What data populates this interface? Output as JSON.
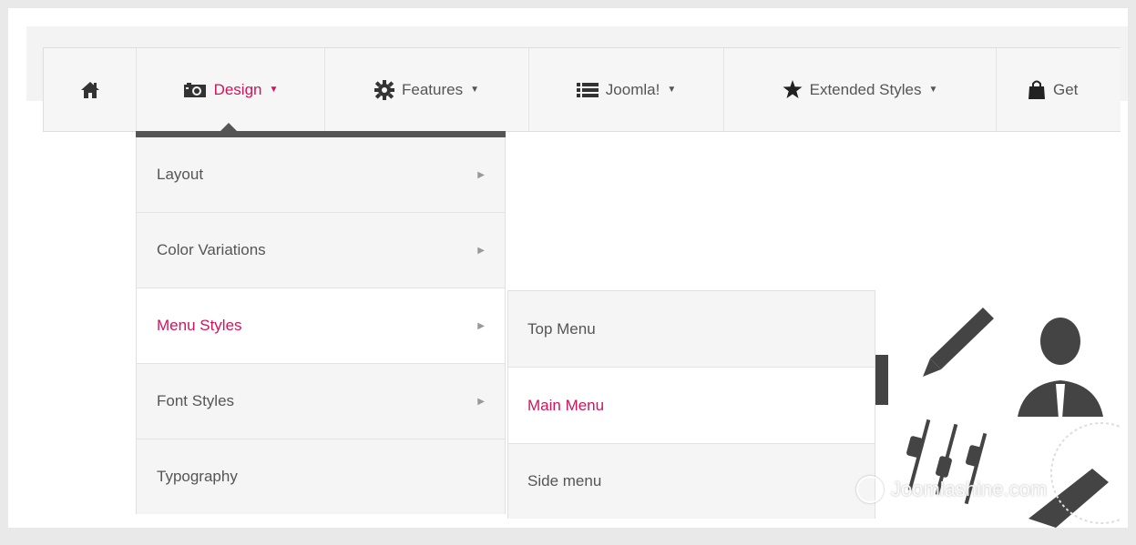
{
  "nav": {
    "items": [
      {
        "label": "",
        "icon": "home-icon"
      },
      {
        "label": "Design",
        "icon": "camera-icon",
        "active": true
      },
      {
        "label": "Features",
        "icon": "gear-icon"
      },
      {
        "label": "Joomla!",
        "icon": "list-icon"
      },
      {
        "label": "Extended Styles",
        "icon": "star-icon"
      },
      {
        "label": "Get",
        "icon": "shopping-bag-icon"
      }
    ]
  },
  "dropdown": {
    "items": [
      {
        "label": "Layout"
      },
      {
        "label": "Color Variations"
      },
      {
        "label": "Menu Styles",
        "active": true
      },
      {
        "label": "Font Styles"
      },
      {
        "label": "Typography"
      }
    ]
  },
  "submenu": {
    "items": [
      {
        "label": "Top Menu"
      },
      {
        "label": "Main Menu",
        "active": true
      },
      {
        "label": "Side menu"
      }
    ]
  },
  "watermark": {
    "text": "Joomlashine.com"
  },
  "colors": {
    "accent": "#d0145b",
    "text": "#555555",
    "bar": "#555555"
  }
}
